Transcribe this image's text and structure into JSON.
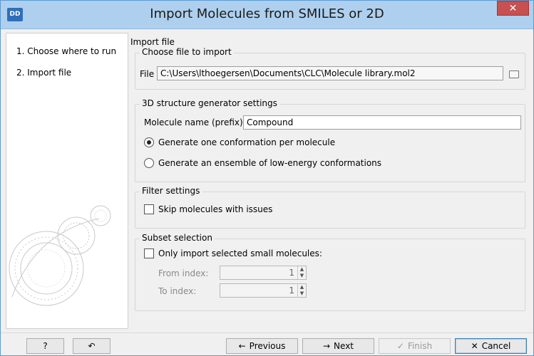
{
  "window": {
    "app_icon_text": "DD",
    "title": "Import Molecules from SMILES or 2D",
    "close_glyph": "✕"
  },
  "steps": [
    {
      "label": "1.  Choose where to run"
    },
    {
      "label": "2.  Import file"
    }
  ],
  "content": {
    "header": "Import file",
    "file_group": {
      "title": "Choose file to import",
      "file_label": "File",
      "file_value": "C:\\Users\\lthoegersen\\Documents\\CLC\\Molecule library.mol2"
    },
    "generator_group": {
      "title": "3D structure generator settings",
      "prefix_label": "Molecule name (prefix)",
      "prefix_value": "Compound",
      "option_one": "Generate one conformation per molecule",
      "option_ensemble": "Generate an ensemble of low-energy conformations",
      "selected": "one"
    },
    "filter_group": {
      "title": "Filter settings",
      "skip_label": "Skip molecules with issues",
      "skip_checked": false
    },
    "subset_group": {
      "title": "Subset selection",
      "only_label": "Only import selected small molecules:",
      "only_checked": false,
      "from_label": "From index:",
      "from_value": "1",
      "to_label": "To index:",
      "to_value": "1"
    }
  },
  "buttons": {
    "help": "?",
    "reset_icon": "↶",
    "previous": "Previous",
    "previous_icon": "←",
    "next": "Next",
    "next_icon": "→",
    "finish": "Finish",
    "finish_icon": "✓",
    "cancel": "Cancel",
    "cancel_icon": "✕"
  },
  "colors": {
    "titlebar": "#aed0ee",
    "close": "#c75050",
    "accent": "#3c7fb1"
  }
}
